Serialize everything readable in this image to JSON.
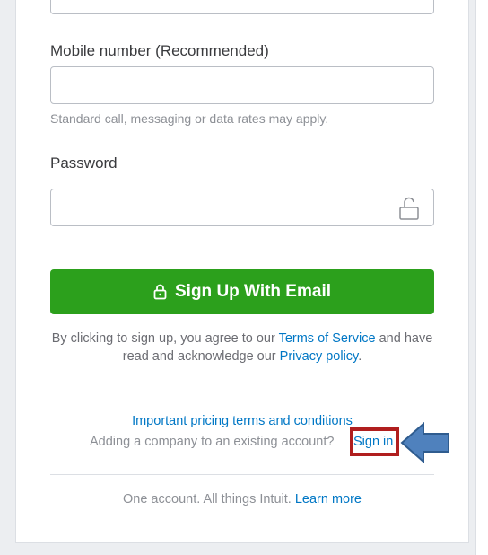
{
  "form": {
    "mobile_label": "Mobile number (Recommended)",
    "mobile_value": "",
    "mobile_helper": "Standard call, messaging or data rates may apply.",
    "password_label": "Password",
    "password_value": "",
    "signup_button": "Sign Up With Email"
  },
  "terms": {
    "prefix": "By clicking to sign up, you agree to our",
    "tos_link": "Terms of Service",
    "middle": "and have read and acknowledge our",
    "privacy_link": "Privacy policy",
    "suffix": "."
  },
  "links": {
    "pricing": "Important pricing terms and conditions",
    "existing_text": "Adding a company to an existing account?",
    "sign_in": "Sign in"
  },
  "footer": {
    "text": "One account. All things Intuit.",
    "learn_more": "Learn more"
  },
  "colors": {
    "accent_green": "#2ca01c",
    "link_blue": "#0077c5",
    "highlight_red": "#b01e1e",
    "arrow_blue": "#4f81bd"
  }
}
